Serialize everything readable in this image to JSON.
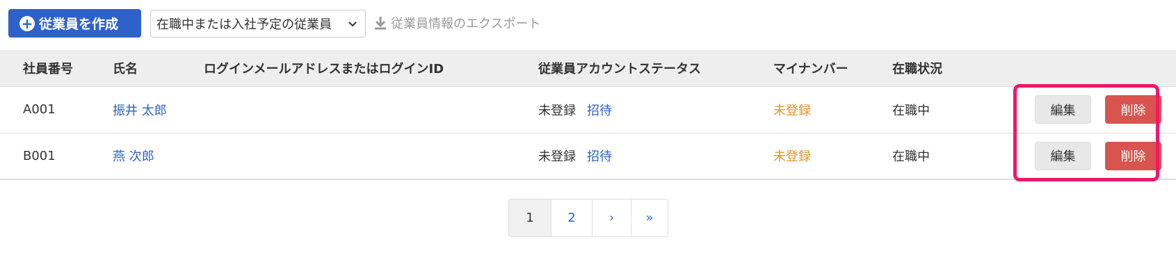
{
  "toolbar": {
    "create_button_label": "従業員を作成",
    "plus_icon_glyph": "+",
    "filter_selected": "在職中または入社予定の従業員",
    "export_label": "従業員情報のエクスポート"
  },
  "table": {
    "headers": [
      "社員番号",
      "氏名",
      "ログインメールアドレスまたはログインID",
      "従業員アカウントステータス",
      "マイナンバー",
      "在職状況"
    ],
    "rows": [
      {
        "id": "A001",
        "name": "振井 太郎",
        "login": "",
        "account_status": "未登録",
        "invite": "招待",
        "my_number": "未登録",
        "employment": "在職中",
        "edit": "編集",
        "delete": "削除"
      },
      {
        "id": "B001",
        "name": "燕 次郎",
        "login": "",
        "account_status": "未登録",
        "invite": "招待",
        "my_number": "未登録",
        "employment": "在職中",
        "edit": "編集",
        "delete": "削除"
      }
    ]
  },
  "pagination": {
    "pages": [
      "1",
      "2"
    ],
    "next": "›",
    "last": "»",
    "current": "1"
  },
  "colors": {
    "primary": "#2e62c9",
    "danger": "#d9534f",
    "warning_text": "#e0942a",
    "highlight": "#f0186a"
  }
}
